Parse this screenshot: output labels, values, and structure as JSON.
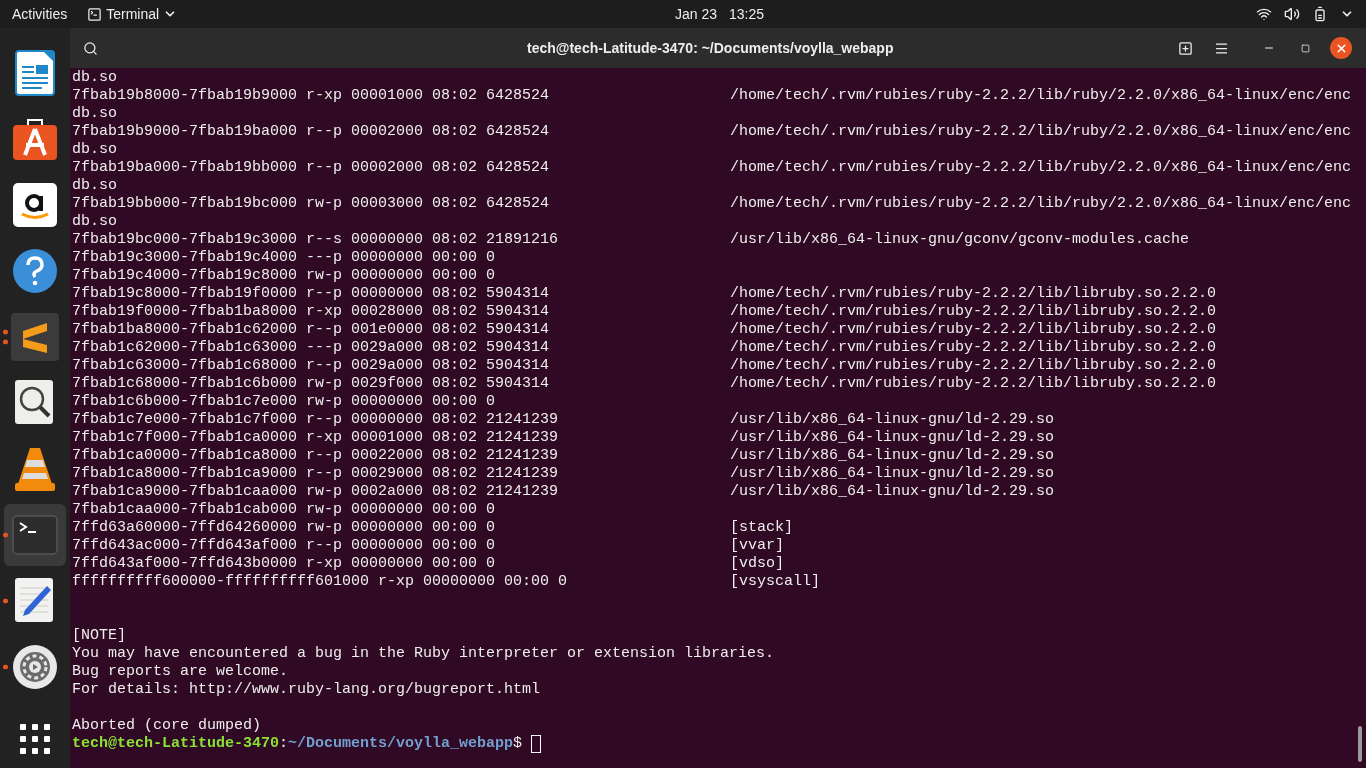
{
  "top_bar": {
    "activities": "Activities",
    "app_menu": "Terminal",
    "date": "Jan 23",
    "time": "13:25"
  },
  "dock": {
    "items": [
      {
        "kind": "writer",
        "running": false,
        "selected": false
      },
      {
        "kind": "store",
        "running": false,
        "selected": false
      },
      {
        "kind": "amazon",
        "running": false,
        "selected": false
      },
      {
        "kind": "help",
        "running": false,
        "selected": false
      },
      {
        "kind": "sublime",
        "running": true,
        "multiple_windows": true,
        "selected": false
      },
      {
        "kind": "magnifier",
        "running": false,
        "selected": false
      },
      {
        "kind": "vlc",
        "running": false,
        "selected": false
      },
      {
        "kind": "terminal",
        "running": true,
        "multiple_windows": false,
        "selected": true
      },
      {
        "kind": "editor",
        "running": true,
        "multiple_windows": false,
        "selected": false
      },
      {
        "kind": "settings",
        "running": true,
        "multiple_windows": false,
        "selected": false
      }
    ]
  },
  "window": {
    "title": "tech@tech-Latitude-3470: ~/Documents/voylla_webapp"
  },
  "terminal": {
    "lines": [
      {
        "kind": "text",
        "text": "db.so"
      },
      {
        "kind": "mapping",
        "text": "7fbab19b8000-7fbab19b9000 r-xp 00001000 08:02 6428524",
        "path": "/home/tech/.rvm/rubies/ruby-2.2.2/lib/ruby/2.2.0/x86_64-linux/enc/enc"
      },
      {
        "kind": "text",
        "text": "db.so"
      },
      {
        "kind": "mapping",
        "text": "7fbab19b9000-7fbab19ba000 r--p 00002000 08:02 6428524",
        "path": "/home/tech/.rvm/rubies/ruby-2.2.2/lib/ruby/2.2.0/x86_64-linux/enc/enc"
      },
      {
        "kind": "text",
        "text": "db.so"
      },
      {
        "kind": "mapping",
        "text": "7fbab19ba000-7fbab19bb000 r--p 00002000 08:02 6428524",
        "path": "/home/tech/.rvm/rubies/ruby-2.2.2/lib/ruby/2.2.0/x86_64-linux/enc/enc"
      },
      {
        "kind": "text",
        "text": "db.so"
      },
      {
        "kind": "mapping",
        "text": "7fbab19bb000-7fbab19bc000 rw-p 00003000 08:02 6428524",
        "path": "/home/tech/.rvm/rubies/ruby-2.2.2/lib/ruby/2.2.0/x86_64-linux/enc/enc"
      },
      {
        "kind": "text",
        "text": "db.so"
      },
      {
        "kind": "mapping",
        "text": "7fbab19bc000-7fbab19c3000 r--s 00000000 08:02 21891216",
        "path": "/usr/lib/x86_64-linux-gnu/gconv/gconv-modules.cache"
      },
      {
        "kind": "mapping",
        "text": "7fbab19c3000-7fbab19c4000 ---p 00000000 00:00 0"
      },
      {
        "kind": "mapping",
        "text": "7fbab19c4000-7fbab19c8000 rw-p 00000000 00:00 0"
      },
      {
        "kind": "mapping",
        "text": "7fbab19c8000-7fbab19f0000 r--p 00000000 08:02 5904314",
        "path": "/home/tech/.rvm/rubies/ruby-2.2.2/lib/libruby.so.2.2.0"
      },
      {
        "kind": "mapping",
        "text": "7fbab19f0000-7fbab1ba8000 r-xp 00028000 08:02 5904314",
        "path": "/home/tech/.rvm/rubies/ruby-2.2.2/lib/libruby.so.2.2.0"
      },
      {
        "kind": "mapping",
        "text": "7fbab1ba8000-7fbab1c62000 r--p 001e0000 08:02 5904314",
        "path": "/home/tech/.rvm/rubies/ruby-2.2.2/lib/libruby.so.2.2.0"
      },
      {
        "kind": "mapping",
        "text": "7fbab1c62000-7fbab1c63000 ---p 0029a000 08:02 5904314",
        "path": "/home/tech/.rvm/rubies/ruby-2.2.2/lib/libruby.so.2.2.0"
      },
      {
        "kind": "mapping",
        "text": "7fbab1c63000-7fbab1c68000 r--p 0029a000 08:02 5904314",
        "path": "/home/tech/.rvm/rubies/ruby-2.2.2/lib/libruby.so.2.2.0"
      },
      {
        "kind": "mapping",
        "text": "7fbab1c68000-7fbab1c6b000 rw-p 0029f000 08:02 5904314",
        "path": "/home/tech/.rvm/rubies/ruby-2.2.2/lib/libruby.so.2.2.0"
      },
      {
        "kind": "mapping",
        "text": "7fbab1c6b000-7fbab1c7e000 rw-p 00000000 00:00 0"
      },
      {
        "kind": "mapping",
        "text": "7fbab1c7e000-7fbab1c7f000 r--p 00000000 08:02 21241239",
        "path": "/usr/lib/x86_64-linux-gnu/ld-2.29.so"
      },
      {
        "kind": "mapping",
        "text": "7fbab1c7f000-7fbab1ca0000 r-xp 00001000 08:02 21241239",
        "path": "/usr/lib/x86_64-linux-gnu/ld-2.29.so"
      },
      {
        "kind": "mapping",
        "text": "7fbab1ca0000-7fbab1ca8000 r--p 00022000 08:02 21241239",
        "path": "/usr/lib/x86_64-linux-gnu/ld-2.29.so"
      },
      {
        "kind": "mapping",
        "text": "7fbab1ca8000-7fbab1ca9000 r--p 00029000 08:02 21241239",
        "path": "/usr/lib/x86_64-linux-gnu/ld-2.29.so"
      },
      {
        "kind": "mapping",
        "text": "7fbab1ca9000-7fbab1caa000 rw-p 0002a000 08:02 21241239",
        "path": "/usr/lib/x86_64-linux-gnu/ld-2.29.so"
      },
      {
        "kind": "mapping",
        "text": "7fbab1caa000-7fbab1cab000 rw-p 00000000 00:00 0"
      },
      {
        "kind": "mapping",
        "text": "7ffd63a60000-7ffd64260000 rw-p 00000000 00:00 0",
        "path": "[stack]"
      },
      {
        "kind": "mapping",
        "text": "7ffd643ac000-7ffd643af000 r--p 00000000 00:00 0",
        "path": "[vvar]"
      },
      {
        "kind": "mapping",
        "text": "7ffd643af000-7ffd643b0000 r-xp 00000000 00:00 0",
        "path": "[vdso]"
      },
      {
        "kind": "mapping",
        "text": "ffffffffff600000-ffffffffff601000 r-xp 00000000 00:00 0",
        "path": "[vsyscall]"
      },
      {
        "kind": "blank"
      },
      {
        "kind": "blank"
      },
      {
        "kind": "text",
        "text": "[NOTE]"
      },
      {
        "kind": "text",
        "text": "You may have encountered a bug in the Ruby interpreter or extension libraries."
      },
      {
        "kind": "text",
        "text": "Bug reports are welcome."
      },
      {
        "kind": "text",
        "text": "For details: http://www.ruby-lang.org/bugreport.html"
      },
      {
        "kind": "blank"
      },
      {
        "kind": "text",
        "text": "Aborted (core dumped)"
      },
      {
        "kind": "prompt",
        "user": "tech@tech-Latitude-3470",
        "separator": ":",
        "cwd": "~/Documents/voylla_webapp",
        "symbol": "$"
      }
    ]
  }
}
